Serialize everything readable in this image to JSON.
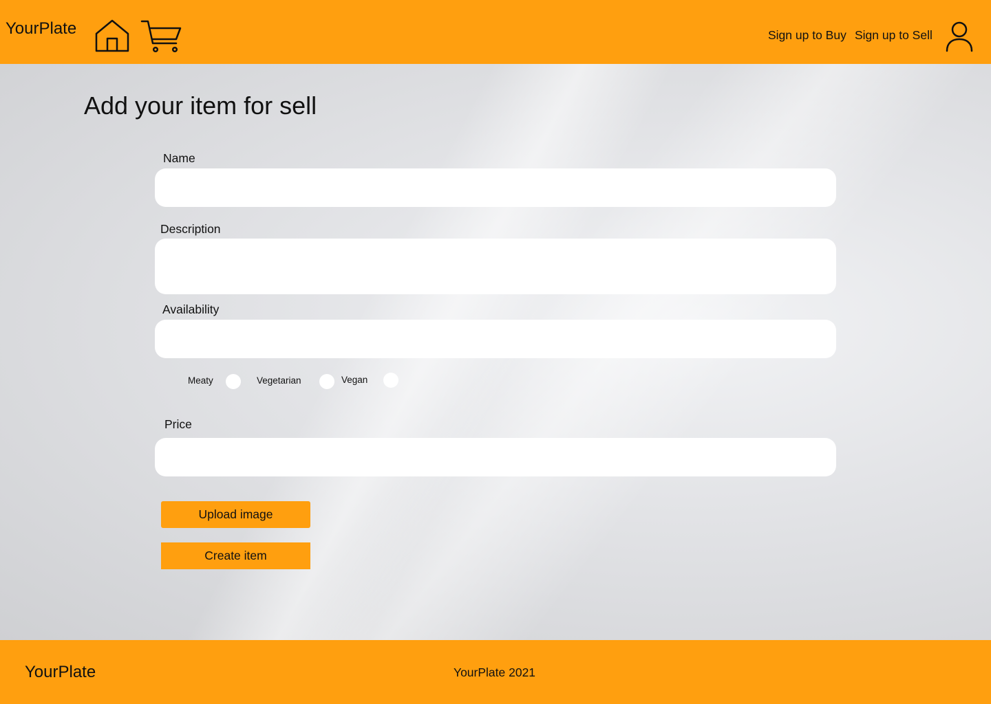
{
  "header": {
    "brand": "YourPlate",
    "icons": {
      "home": "home-icon",
      "cart": "cart-icon",
      "user": "user-icon"
    },
    "nav": {
      "sign_up_buy": "Sign up to Buy",
      "sign_up_sell": "Sign up to Sell"
    }
  },
  "main": {
    "title": "Add your item for sell",
    "fields": {
      "name_label": "Name",
      "name_value": "",
      "description_label": "Description",
      "description_value": "",
      "availability_label": "Availability",
      "availability_value": "",
      "price_label": "Price",
      "price_value": ""
    },
    "diet_options": [
      "Meaty",
      "Vegetarian",
      "Vegan"
    ],
    "buttons": {
      "upload": "Upload image",
      "create": "Create item"
    }
  },
  "footer": {
    "brand": "YourPlate",
    "copyright": "YourPlate 2021"
  },
  "colors": {
    "accent": "#ff9f0f",
    "input_bg": "#ffffff",
    "text": "#111111"
  }
}
